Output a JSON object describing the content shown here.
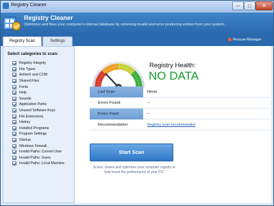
{
  "window": {
    "title": "Registry Cleaner",
    "controls": [
      "–",
      "□",
      "✕"
    ]
  },
  "header": {
    "title": "Registry Cleaner",
    "subtitle": "Optimizes and fixes your computer's internal database by removing invalid and error producing entries from your system."
  },
  "tabs": [
    {
      "label": "Registry Scan",
      "active": true
    },
    {
      "label": "Settings",
      "active": false
    }
  ],
  "rescue_manager": {
    "label": "Rescue Manager",
    "icon": "rescue-icon"
  },
  "categories": {
    "title": "Select categories to scan:",
    "items": [
      {
        "label": "Registry Integrity",
        "checked": true
      },
      {
        "label": "File Types",
        "checked": true
      },
      {
        "label": "ActiveX and COM",
        "checked": true
      },
      {
        "label": "Shared Files",
        "checked": true
      },
      {
        "label": "Fonts",
        "checked": true
      },
      {
        "label": "Help",
        "checked": true
      },
      {
        "label": "Sounds",
        "checked": true
      },
      {
        "label": "Application Paths",
        "checked": true
      },
      {
        "label": "Unused Software Keys",
        "checked": true
      },
      {
        "label": "File Extensions",
        "checked": true
      },
      {
        "label": "History",
        "checked": true
      },
      {
        "label": "Installed Programs",
        "checked": true
      },
      {
        "label": "Program Settings",
        "checked": true
      },
      {
        "label": "Startup",
        "checked": true
      },
      {
        "label": "Windows Firewall",
        "checked": true
      },
      {
        "label": "Invalid Paths: Current User",
        "checked": true
      },
      {
        "label": "Invalid Paths: Users",
        "checked": true
      },
      {
        "label": "Invalid Paths: Local Machine",
        "checked": true
      }
    ]
  },
  "health": {
    "label": "Registry Health:",
    "value": "NO DATA",
    "value_color": "#159c2c"
  },
  "info": [
    {
      "key": "Last Scan:",
      "value": "Never",
      "highlight": true,
      "link": false
    },
    {
      "key": "Errors Found:",
      "value": "--",
      "highlight": false,
      "link": false
    },
    {
      "key": "Errors Fixed:",
      "value": "--",
      "highlight": true,
      "link": false
    },
    {
      "key": "Recommendation:",
      "value": "Registry scan recommended",
      "highlight": false,
      "link": true
    }
  ],
  "start_button": {
    "label": "Start Scan"
  },
  "footnote": "Scans, cleans and optimizes your computer registry to help boost the performance of your PC!",
  "colors": {
    "banner": "#2a69ad",
    "accent_button": "#2f77c4",
    "ok_green": "#159c2c"
  }
}
